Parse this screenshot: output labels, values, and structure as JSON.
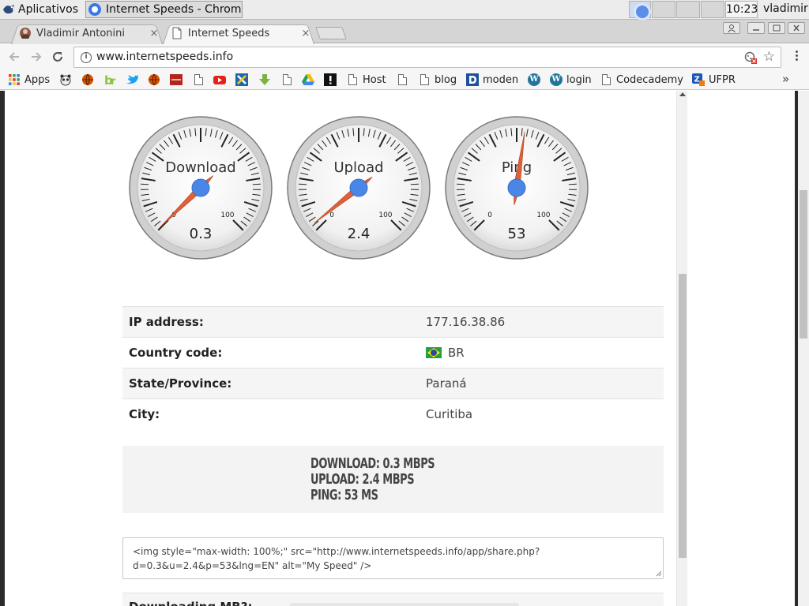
{
  "os": {
    "apps_menu_label": "Aplicativos",
    "task_title": "Internet Speeds - Chrom...",
    "clock": "10:23",
    "user": "vladimir"
  },
  "browser": {
    "tabs": [
      {
        "title": "Vladimir Antonini",
        "close": "×"
      },
      {
        "title": "Internet Speeds",
        "close": "×"
      }
    ],
    "url": "www.internetspeeds.info",
    "bookmarks": [
      {
        "label": "Apps",
        "icon": "apps-grid-icon"
      },
      {
        "label": "",
        "icon": "panda-icon"
      },
      {
        "label": "",
        "icon": "ball-icon"
      },
      {
        "label": "",
        "icon": "bitly-icon"
      },
      {
        "label": "",
        "icon": "twitter-icon"
      },
      {
        "label": "",
        "icon": "ball-icon"
      },
      {
        "label": "",
        "icon": "red-site-icon"
      },
      {
        "label": "",
        "icon": "page-icon"
      },
      {
        "label": "",
        "icon": "youtube-icon"
      },
      {
        "label": "",
        "icon": "x-site-icon"
      },
      {
        "label": "",
        "icon": "download-arrow-icon"
      },
      {
        "label": "",
        "icon": "page-icon"
      },
      {
        "label": "",
        "icon": "google-drive-icon"
      },
      {
        "label": "",
        "icon": "exclamation-icon"
      },
      {
        "label": "Host",
        "icon": "page-icon"
      },
      {
        "label": "",
        "icon": "page-icon"
      },
      {
        "label": "blog",
        "icon": "page-icon"
      },
      {
        "label": "moden",
        "icon": "d-logo-icon"
      },
      {
        "label": "",
        "icon": "wordpress-icon"
      },
      {
        "label": "login",
        "icon": "wordpress-icon"
      },
      {
        "label": "Codecademy",
        "icon": "page-icon"
      },
      {
        "label": "UFPR",
        "icon": "ufpr-icon"
      }
    ],
    "more_bookmarks": "»"
  },
  "gauges": [
    {
      "id": "download",
      "label": "Download",
      "value": 0.3,
      "display": "0.3",
      "min_label": "0",
      "max_label": "100"
    },
    {
      "id": "upload",
      "label": "Upload",
      "value": 2.4,
      "display": "2.4",
      "min_label": "0",
      "max_label": "100"
    },
    {
      "id": "ping",
      "label": "Ping",
      "value": 53,
      "display": "53",
      "min_label": "0",
      "max_label": "100"
    }
  ],
  "info": {
    "ip_label": "IP address:",
    "ip_value": "177.16.38.86",
    "country_label": "Country code:",
    "country_value": "BR",
    "state_label": "State/Province:",
    "state_value": "Paraná",
    "city_label": "City:",
    "city_value": "Curitiba"
  },
  "summary": {
    "download": "DOWNLOAD: 0.3 MBPS",
    "upload": "UPLOAD: 2.4 MBPS",
    "ping": "PING: 53 MS"
  },
  "share_code": "<img style=\"max-width: 100%;\" src=\"http://www.internetspeeds.info/app/share.php?d=0.3&u=2.4&p=53&lng=EN\" alt=\"My Speed\" />",
  "downloading_label": "Downloading MB?:",
  "colors": {
    "needle": "#e0603a",
    "hub": "#4a86e8"
  }
}
